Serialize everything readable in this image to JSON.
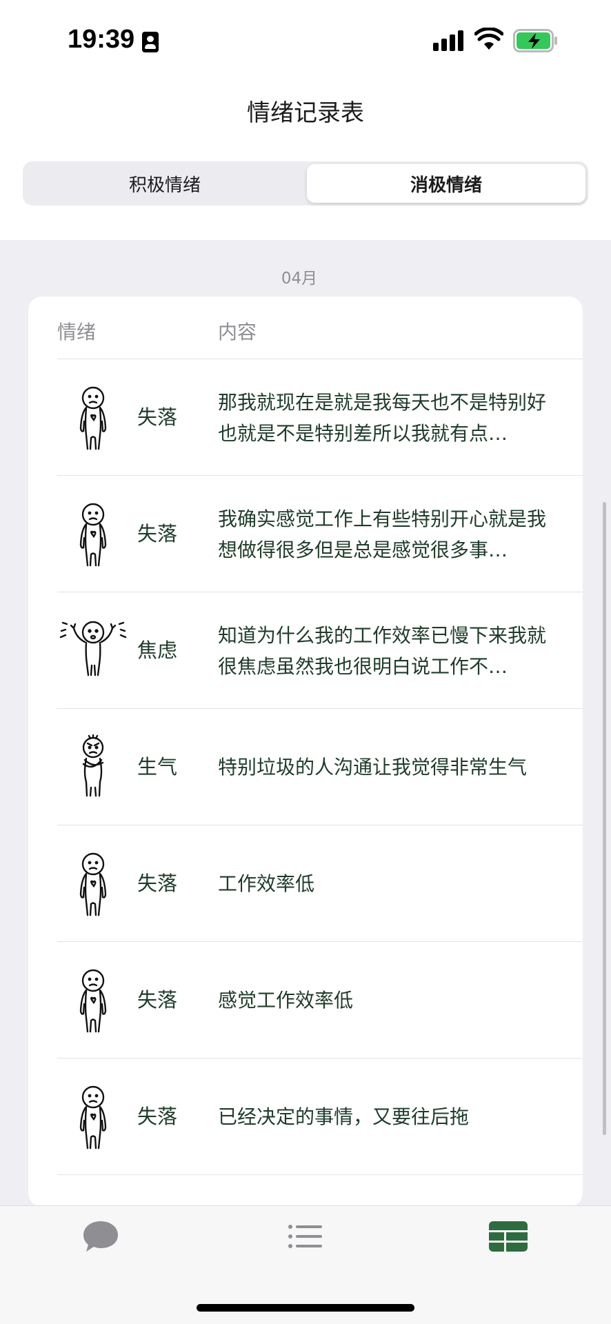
{
  "status_bar": {
    "time": "19:39"
  },
  "header": {
    "title": "情绪记录表"
  },
  "segments": [
    {
      "label": "积极情绪",
      "active": false
    },
    {
      "label": "消极情绪",
      "active": true
    }
  ],
  "month": "04月",
  "table": {
    "columns": {
      "emotion": "情绪",
      "content": "内容"
    },
    "rows": [
      {
        "emotion": "失落",
        "figure": "sad-figure-icon",
        "content": "那我就现在是就是我每天也不是特别好也就是不是特别差所以我就有点…"
      },
      {
        "emotion": "失落",
        "figure": "sad-figure-icon",
        "content": "我确实感觉工作上有些特别开心就是我想做得很多但是总是感觉很多事…"
      },
      {
        "emotion": "焦虑",
        "figure": "anxious-figure-icon",
        "content": "知道为什么我的工作效率已慢下来我就很焦虑虽然我也很明白说工作不…"
      },
      {
        "emotion": "生气",
        "figure": "angry-figure-icon",
        "content": "特别垃圾的人沟通让我觉得非常生气"
      },
      {
        "emotion": "失落",
        "figure": "sad-figure-icon",
        "content": "工作效率低"
      },
      {
        "emotion": "失落",
        "figure": "sad-figure-icon",
        "content": "感觉工作效率低"
      },
      {
        "emotion": "失落",
        "figure": "sad-figure-icon",
        "content": "已经决定的事情，又要往后拖"
      }
    ]
  },
  "tab_bar": {
    "items": [
      {
        "icon": "chat-bubble-icon",
        "active": false
      },
      {
        "icon": "list-icon",
        "active": false
      },
      {
        "icon": "table-icon",
        "active": true
      }
    ]
  },
  "colors": {
    "accent": "#2e6b3f",
    "text_green": "#1f3b2a",
    "inactive_icon": "#8e8e93"
  }
}
